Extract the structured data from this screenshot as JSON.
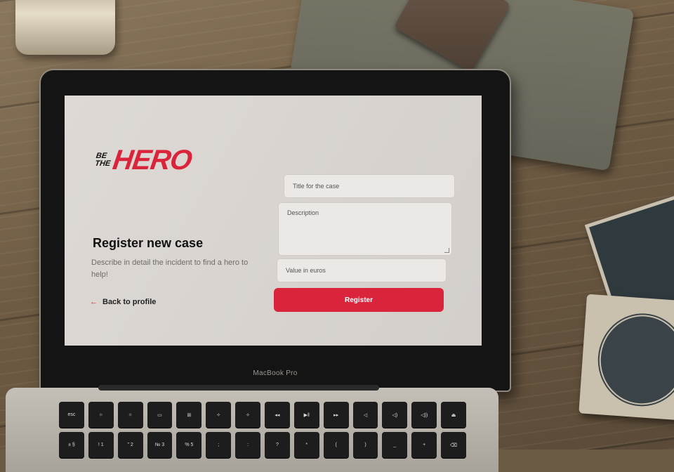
{
  "logo": {
    "line1": "BE",
    "line2": "THE",
    "main": "HERO"
  },
  "page": {
    "title": "Register new case",
    "description": "Describe in detail the incident to find a hero to help!",
    "back_link": "Back to profile"
  },
  "form": {
    "title_placeholder": "Title for the case",
    "description_placeholder": "Description",
    "value_placeholder": "Value in euros",
    "submit_label": "Register"
  },
  "device": {
    "label": "MacBook Pro"
  },
  "keyboard": {
    "row1": [
      "esc",
      "☼",
      "☼",
      "▭",
      "⊞",
      "✧",
      "✧",
      "◂◂",
      "▶‖",
      "▸▸",
      "◁",
      "◁)",
      "◁))",
      "⏏"
    ],
    "row2": [
      "± §",
      "! 1",
      "\" 2",
      "№ 3",
      "% 5",
      ";",
      ":",
      "?",
      "*",
      "(",
      ")",
      "_",
      "+",
      "⌫"
    ]
  },
  "colors": {
    "accent": "#d9243b",
    "screen_bg": "#dcd7d3"
  }
}
